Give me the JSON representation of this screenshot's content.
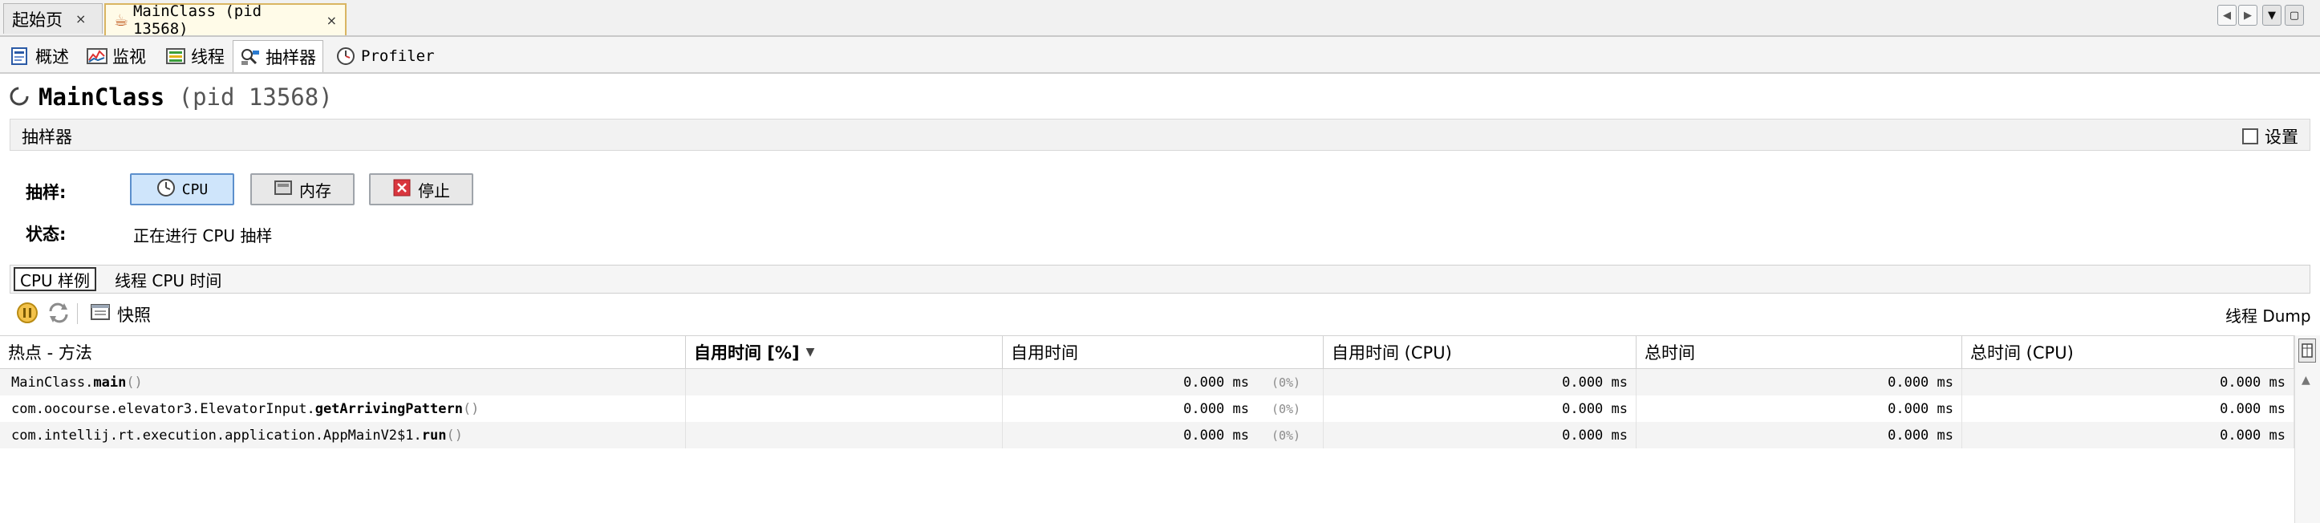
{
  "doc_tabs": [
    {
      "label": "起始页",
      "close": "×"
    },
    {
      "label": "MainClass (pid 13568)",
      "close": "×"
    }
  ],
  "view_tabs": [
    {
      "label": "概述"
    },
    {
      "label": "监视"
    },
    {
      "label": "线程"
    },
    {
      "label": "抽样器"
    },
    {
      "label": "Profiler"
    }
  ],
  "header": {
    "title_main": "MainClass",
    "title_pid": "(pid 13568)"
  },
  "section": {
    "label": "抽样器",
    "settings_label": "设置"
  },
  "sampling": {
    "label": "抽样:",
    "cpu_button": "CPU",
    "memory_button": "内存",
    "stop_button": "停止",
    "status_label": "状态:",
    "status_value": "正在进行 CPU 抽样"
  },
  "subtabs": [
    {
      "label": "CPU 样例"
    },
    {
      "label": "线程 CPU 时间"
    }
  ],
  "toolbar": {
    "snapshot_label": "快照",
    "thread_dump_label": "线程 Dump"
  },
  "table": {
    "columns": [
      "热点 - 方法",
      "自用时间 [%]",
      "自用时间",
      "自用时间 (CPU)",
      "总时间",
      "总时间 (CPU)"
    ],
    "rows": [
      {
        "pkg": "MainClass.",
        "method": "main",
        "args": " ()",
        "self_time": "0.000 ms",
        "self_pct": "(0%)",
        "self_cpu": "0.000 ms",
        "total": "0.000 ms",
        "total_cpu": "0.000 ms"
      },
      {
        "pkg": "com.oocourse.elevator3.ElevatorInput.",
        "method": "getArrivingPattern",
        "args": " ()",
        "self_time": "0.000 ms",
        "self_pct": "(0%)",
        "self_cpu": "0.000 ms",
        "total": "0.000 ms",
        "total_cpu": "0.000 ms"
      },
      {
        "pkg": "com.intellij.rt.execution.application.AppMainV2$1.",
        "method": "run",
        "args": " ()",
        "self_time": "0.000 ms",
        "self_pct": "(0%)",
        "self_cpu": "0.000 ms",
        "total": "0.000 ms",
        "total_cpu": "0.000 ms"
      }
    ]
  },
  "colors": {
    "accent_selected": "#cfe5fb",
    "active_tab_border": "#d9b562",
    "stop_red": "#d9363e"
  }
}
